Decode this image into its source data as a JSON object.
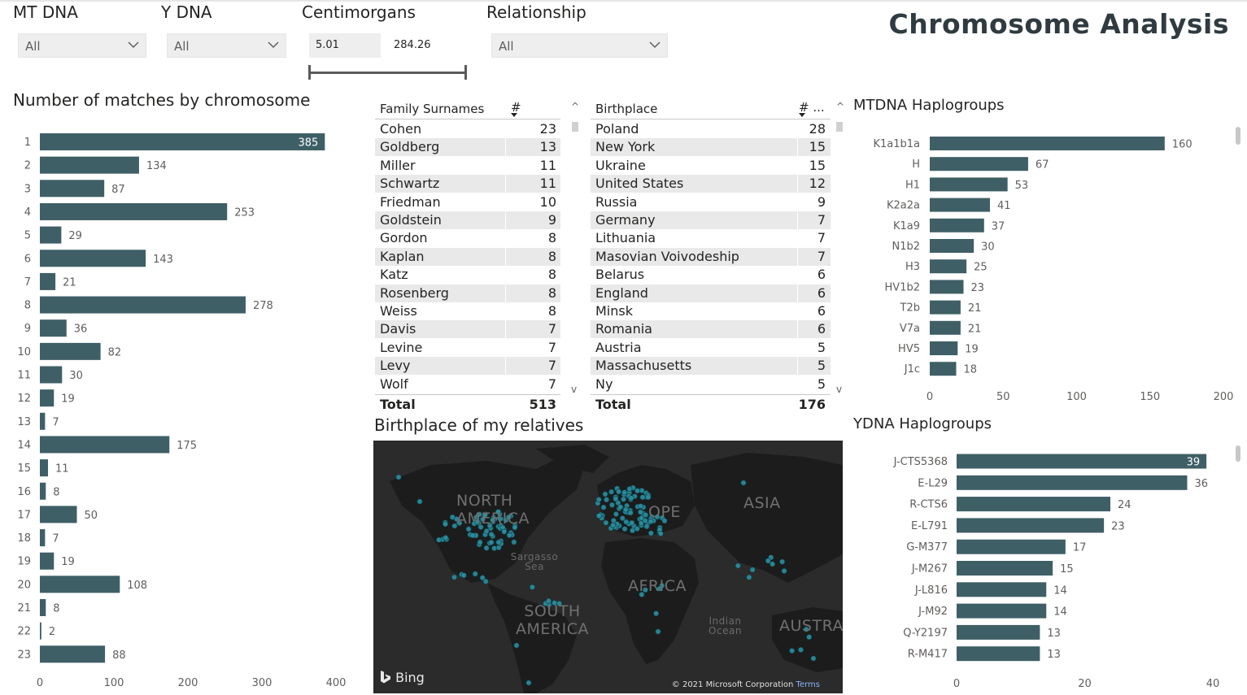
{
  "page_title": "Chromosome Analysis",
  "slicers": {
    "mt_dna": {
      "title": "MT DNA",
      "value": "All"
    },
    "y_dna": {
      "title": "Y DNA",
      "value": "All"
    },
    "centimorgans": {
      "title": "Centimorgans",
      "min": "5.01",
      "max": "284.26"
    },
    "relationship": {
      "title": "Relationship",
      "value": "All"
    }
  },
  "chromosome_chart": {
    "title": "Number of matches by chromosome",
    "chart_data": {
      "type": "bar",
      "orientation": "horizontal",
      "categories": [
        "1",
        "2",
        "3",
        "4",
        "5",
        "6",
        "7",
        "8",
        "9",
        "10",
        "11",
        "12",
        "13",
        "14",
        "15",
        "16",
        "17",
        "18",
        "19",
        "20",
        "21",
        "22",
        "23"
      ],
      "values": [
        385,
        134,
        87,
        253,
        29,
        143,
        21,
        278,
        36,
        82,
        30,
        19,
        7,
        175,
        11,
        8,
        50,
        7,
        19,
        108,
        8,
        2,
        88
      ],
      "xlim": [
        0,
        400
      ],
      "ticks": [
        "0",
        "100",
        "200",
        "300",
        "400"
      ],
      "color": "#3f5f66"
    }
  },
  "surnames_table": {
    "col1": "Family Surnames",
    "col2": "#",
    "rows": [
      {
        "name": "Cohen",
        "count": "23"
      },
      {
        "name": "Goldberg",
        "count": "13"
      },
      {
        "name": "Miller",
        "count": "11"
      },
      {
        "name": "Schwartz",
        "count": "11"
      },
      {
        "name": "Friedman",
        "count": "10"
      },
      {
        "name": "Goldstein",
        "count": "9"
      },
      {
        "name": "Gordon",
        "count": "8"
      },
      {
        "name": "Kaplan",
        "count": "8"
      },
      {
        "name": "Katz",
        "count": "8"
      },
      {
        "name": "Rosenberg",
        "count": "8"
      },
      {
        "name": "Weiss",
        "count": "8"
      },
      {
        "name": "Davis",
        "count": "7"
      },
      {
        "name": "Levine",
        "count": "7"
      },
      {
        "name": "Levy",
        "count": "7"
      },
      {
        "name": "Wolf",
        "count": "7"
      }
    ],
    "total_label": "Total",
    "total_value": "513"
  },
  "birthplace_table": {
    "col1": "Birthplace",
    "col2": "# ...",
    "rows": [
      {
        "name": "Poland",
        "count": "28"
      },
      {
        "name": "New York",
        "count": "15"
      },
      {
        "name": "Ukraine",
        "count": "15"
      },
      {
        "name": "United States",
        "count": "12"
      },
      {
        "name": "Russia",
        "count": "9"
      },
      {
        "name": "Germany",
        "count": "7"
      },
      {
        "name": "Lithuania",
        "count": "7"
      },
      {
        "name": "Masovian Voivodeship",
        "count": "7"
      },
      {
        "name": "Belarus",
        "count": "6"
      },
      {
        "name": "England",
        "count": "6"
      },
      {
        "name": "Minsk",
        "count": "6"
      },
      {
        "name": "Romania",
        "count": "6"
      },
      {
        "name": "Austria",
        "count": "5"
      },
      {
        "name": "Massachusetts",
        "count": "5"
      },
      {
        "name": "Ny",
        "count": "5"
      }
    ],
    "total_label": "Total",
    "total_value": "176"
  },
  "mtdna_chart": {
    "title": "MTDNA Haplogroups",
    "chart_data": {
      "type": "bar",
      "orientation": "horizontal",
      "categories": [
        "K1a1b1a",
        "H",
        "H1",
        "K2a2a",
        "K1a9",
        "N1b2",
        "H3",
        "HV1b2",
        "T2b",
        "V7a",
        "HV5",
        "J1c"
      ],
      "values": [
        160,
        67,
        53,
        41,
        37,
        30,
        25,
        23,
        21,
        21,
        19,
        18
      ],
      "xlim": [
        0,
        200
      ],
      "ticks": [
        "0",
        "50",
        "100",
        "150",
        "200"
      ],
      "color": "#3f5f66"
    }
  },
  "ydna_chart": {
    "title": "YDNA Haplogroups",
    "chart_data": {
      "type": "bar",
      "orientation": "horizontal",
      "categories": [
        "J-CTS5368",
        "E-L29",
        "R-CTS6",
        "E-L791",
        "G-M377",
        "J-M267",
        "J-L816",
        "J-M92",
        "Q-Y2197",
        "R-M417"
      ],
      "values": [
        39,
        36,
        24,
        23,
        17,
        15,
        14,
        14,
        13,
        13
      ],
      "xlim": [
        0,
        40
      ],
      "ticks": [
        "0",
        "20",
        "40"
      ],
      "color": "#3f5f66"
    }
  },
  "map": {
    "title": "Birthplace of my relatives",
    "labels": {
      "north_america": "NORTH AMERICA",
      "europe": "OPE",
      "asia": "ASIA",
      "africa": "AFRICA",
      "south_america": "SOUTH AMERICA",
      "australia": "AUSTRA",
      "sargasso": "Sargasso Sea",
      "indian_ocean": "Indian Ocean"
    },
    "provider": "Bing",
    "copyright": "© 2021 Microsoft Corporation",
    "terms": "Terms",
    "dot_color": "#2b8fa0"
  }
}
